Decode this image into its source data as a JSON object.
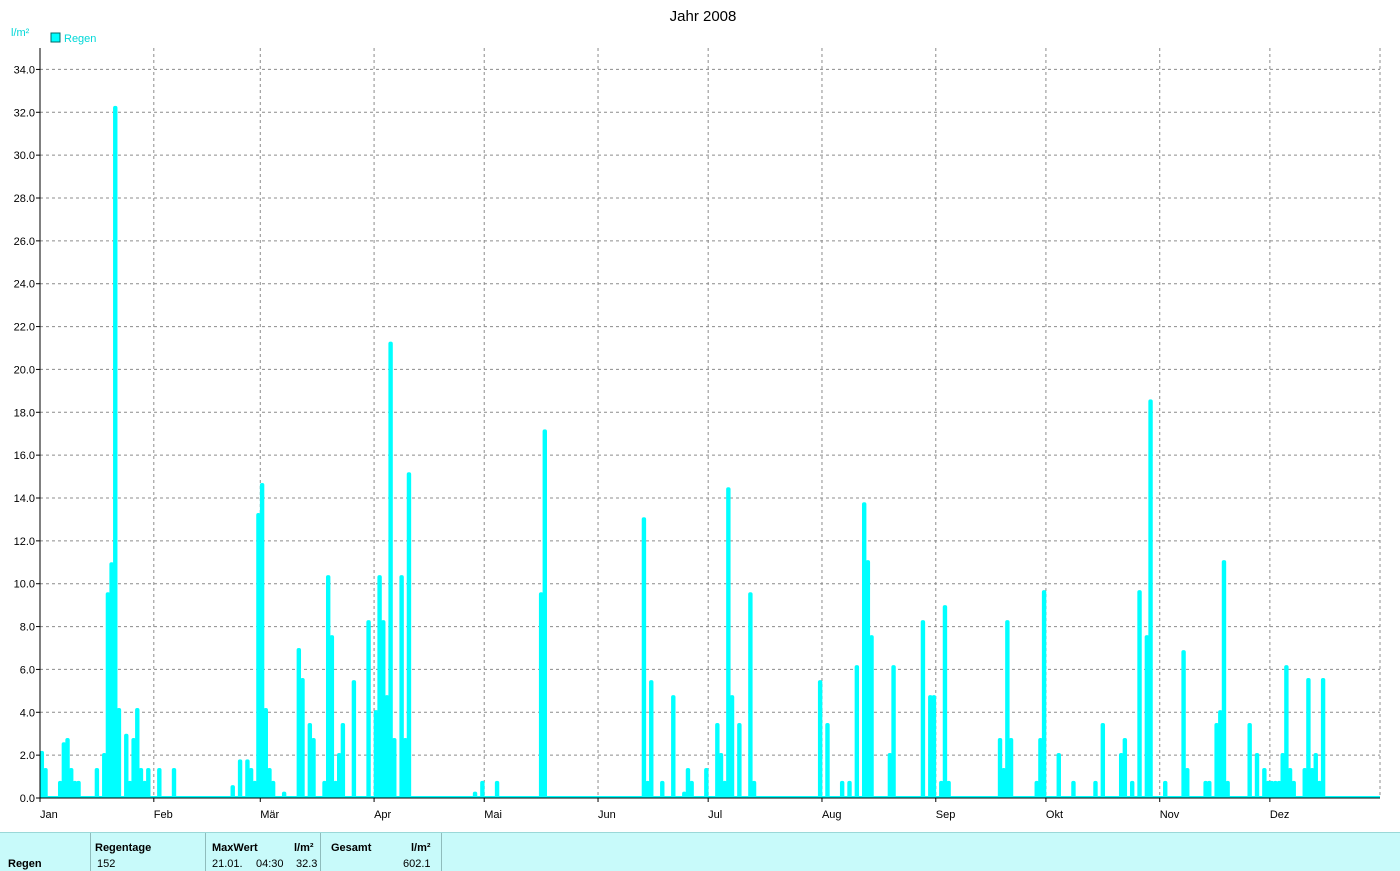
{
  "chart_data": {
    "type": "bar",
    "title": "Jahr 2008",
    "ylabel": "l/m²",
    "ylim": [
      0,
      35
    ],
    "y_ticks": [
      "0.0",
      "2.0",
      "4.0",
      "6.0",
      "8.0",
      "10.0",
      "12.0",
      "14.0",
      "16.0",
      "18.0",
      "20.0",
      "22.0",
      "24.0",
      "26.0",
      "28.0",
      "30.0",
      "32.0",
      "34.0"
    ],
    "x_axis_ticks": [
      "Jan",
      "Feb",
      "Mär",
      "Apr",
      "Mai",
      "Jun",
      "Jul",
      "Aug",
      "Sep",
      "Okt",
      "Nov",
      "Dez"
    ],
    "x_range_days": [
      1,
      366
    ],
    "grid": true,
    "legend_position": "top-left",
    "series": [
      {
        "name": "Regen",
        "color": "#00ffff",
        "points": [
          [
            1,
            2.2
          ],
          [
            2,
            1.4
          ],
          [
            6,
            0.8
          ],
          [
            7,
            2.6
          ],
          [
            8,
            2.8
          ],
          [
            9,
            1.4
          ],
          [
            10,
            0.8
          ],
          [
            11,
            0.8
          ],
          [
            16,
            1.4
          ],
          [
            18,
            2.1
          ],
          [
            19,
            9.6
          ],
          [
            20,
            11.0
          ],
          [
            21,
            32.3
          ],
          [
            22,
            4.2
          ],
          [
            24,
            3.0
          ],
          [
            25,
            0.8
          ],
          [
            26,
            2.8
          ],
          [
            27,
            4.2
          ],
          [
            28,
            1.4
          ],
          [
            29,
            0.8
          ],
          [
            30,
            1.4
          ],
          [
            33,
            1.4
          ],
          [
            37,
            1.4
          ],
          [
            53,
            0.6
          ],
          [
            55,
            1.8
          ],
          [
            57,
            1.8
          ],
          [
            58,
            1.4
          ],
          [
            59,
            0.8
          ],
          [
            60,
            13.3
          ],
          [
            61,
            14.7
          ],
          [
            62,
            4.2
          ],
          [
            63,
            1.4
          ],
          [
            64,
            0.8
          ],
          [
            67,
            0.3
          ],
          [
            71,
            7.0
          ],
          [
            72,
            5.6
          ],
          [
            74,
            3.5
          ],
          [
            75,
            2.8
          ],
          [
            78,
            0.8
          ],
          [
            79,
            10.4
          ],
          [
            80,
            7.6
          ],
          [
            81,
            0.8
          ],
          [
            82,
            2.1
          ],
          [
            83,
            3.5
          ],
          [
            86,
            5.5
          ],
          [
            90,
            8.3
          ],
          [
            92,
            4.1
          ],
          [
            93,
            10.4
          ],
          [
            94,
            8.3
          ],
          [
            95,
            4.8
          ],
          [
            96,
            21.3
          ],
          [
            97,
            2.8
          ],
          [
            99,
            10.4
          ],
          [
            100,
            2.8
          ],
          [
            101,
            15.2
          ],
          [
            119,
            0.3
          ],
          [
            121,
            0.8
          ],
          [
            125,
            0.8
          ],
          [
            137,
            9.6
          ],
          [
            138,
            17.2
          ],
          [
            165,
            13.1
          ],
          [
            166,
            0.8
          ],
          [
            167,
            5.5
          ],
          [
            170,
            0.8
          ],
          [
            173,
            4.8
          ],
          [
            176,
            0.3
          ],
          [
            177,
            1.4
          ],
          [
            178,
            0.8
          ],
          [
            182,
            1.4
          ],
          [
            185,
            3.5
          ],
          [
            186,
            2.1
          ],
          [
            187,
            0.8
          ],
          [
            188,
            14.5
          ],
          [
            189,
            4.8
          ],
          [
            191,
            3.5
          ],
          [
            194,
            9.6
          ],
          [
            195,
            0.8
          ],
          [
            213,
            5.5
          ],
          [
            215,
            3.5
          ],
          [
            219,
            0.8
          ],
          [
            221,
            0.8
          ],
          [
            223,
            6.2
          ],
          [
            225,
            13.8
          ],
          [
            226,
            11.1
          ],
          [
            227,
            7.6
          ],
          [
            232,
            2.1
          ],
          [
            233,
            6.2
          ],
          [
            241,
            8.3
          ],
          [
            243,
            4.8
          ],
          [
            244,
            4.8
          ],
          [
            246,
            0.8
          ],
          [
            247,
            9.0
          ],
          [
            248,
            0.8
          ],
          [
            262,
            2.8
          ],
          [
            263,
            1.4
          ],
          [
            264,
            8.3
          ],
          [
            265,
            2.8
          ],
          [
            272,
            0.8
          ],
          [
            273,
            2.8
          ],
          [
            274,
            9.7
          ],
          [
            278,
            2.1
          ],
          [
            282,
            0.8
          ],
          [
            288,
            0.8
          ],
          [
            290,
            3.5
          ],
          [
            295,
            2.1
          ],
          [
            296,
            2.8
          ],
          [
            298,
            0.8
          ],
          [
            300,
            9.7
          ],
          [
            302,
            7.6
          ],
          [
            303,
            18.6
          ],
          [
            307,
            0.8
          ],
          [
            312,
            6.9
          ],
          [
            313,
            1.4
          ],
          [
            318,
            0.8
          ],
          [
            319,
            0.8
          ],
          [
            321,
            3.5
          ],
          [
            322,
            4.1
          ],
          [
            323,
            11.1
          ],
          [
            324,
            0.8
          ],
          [
            330,
            3.5
          ],
          [
            332,
            2.1
          ],
          [
            334,
            1.4
          ],
          [
            335,
            0.8
          ],
          [
            336,
            0.8
          ],
          [
            337,
            0.8
          ],
          [
            338,
            0.8
          ],
          [
            339,
            2.1
          ],
          [
            340,
            6.2
          ],
          [
            341,
            1.4
          ],
          [
            342,
            0.8
          ],
          [
            345,
            1.4
          ],
          [
            346,
            5.6
          ],
          [
            347,
            1.4
          ],
          [
            348,
            2.1
          ],
          [
            349,
            0.8
          ],
          [
            350,
            5.6
          ]
        ]
      }
    ]
  },
  "stats": {
    "row_label": "Regen",
    "regentage_label": "Regentage",
    "regentage_value": "152",
    "maxwert_label": "MaxWert",
    "maxwert_unit": "l/m²",
    "maxwert_date": "21.01.",
    "maxwert_time": "04:30",
    "maxwert_value": "32.3",
    "gesamt_label": "Gesamt",
    "gesamt_unit": "l/m²",
    "gesamt_value": "602.1"
  }
}
